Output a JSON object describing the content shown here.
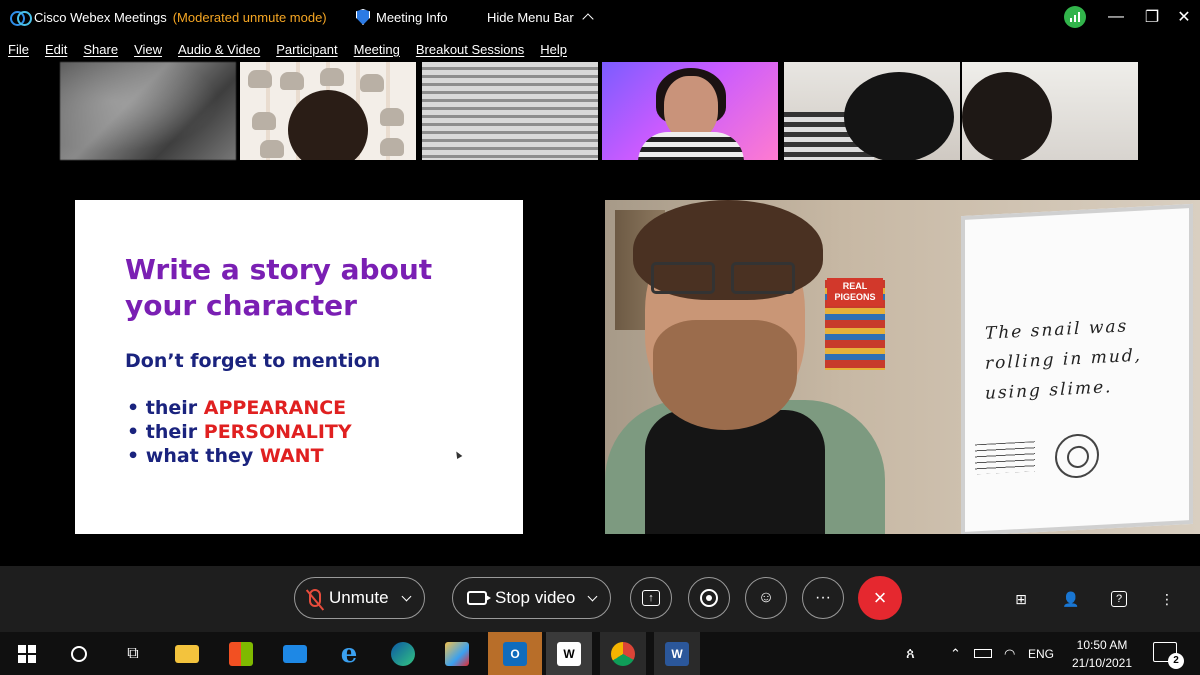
{
  "titlebar": {
    "app_title": "Cisco Webex Meetings",
    "mode": "(Moderated unmute mode)",
    "meeting_info": "Meeting Info",
    "hide_menu_bar": "Hide Menu Bar"
  },
  "menu": {
    "items": [
      "File",
      "Edit",
      "Share",
      "View",
      "Audio & Video",
      "Participant",
      "Meeting",
      "Breakout Sessions",
      "Help"
    ]
  },
  "slide": {
    "title_line1": "Write a story about",
    "title_line2": "your character",
    "subtitle": "Don’t forget to mention",
    "bullets": [
      {
        "prefix": "their ",
        "highlight": "APPEARANCE"
      },
      {
        "prefix": "their ",
        "highlight": "PERSONALITY"
      },
      {
        "prefix": "what they ",
        "highlight": "WANT"
      }
    ],
    "colors": {
      "title": "#7a1fb3",
      "body": "#1a237e",
      "highlight": "#e02020"
    }
  },
  "video": {
    "board_text_l1": "The snail was",
    "board_text_l2": "rolling in mud,",
    "board_text_l3": "using slime.",
    "book_label": "REAL PIGEONS"
  },
  "controls": {
    "unmute": "Unmute",
    "stop_video": "Stop video",
    "more": "···",
    "overflow": "⋮",
    "end_icon": "×"
  },
  "taskbar": {
    "language": "ENG",
    "time": "10:50 AM",
    "date": "21/10/2021",
    "notification_count": "2"
  },
  "accent_colors": {
    "end_call": "#e5282f",
    "signal": "#32b44b",
    "moderated": "#f5a623"
  }
}
